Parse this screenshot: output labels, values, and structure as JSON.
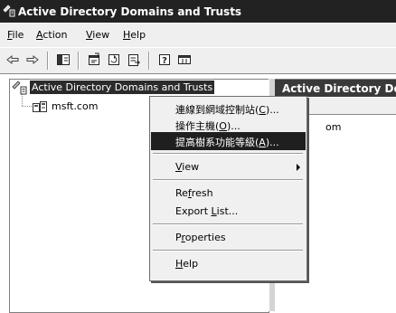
{
  "window": {
    "title": "Active Directory Domains and Trusts",
    "icon": "ad-domains-icon"
  },
  "menubar": [
    {
      "label": "File",
      "key": "F",
      "rest": "ile"
    },
    {
      "label": "Action",
      "key": "A",
      "rest": "ction"
    },
    {
      "label": "View",
      "key": "V",
      "rest": "iew"
    },
    {
      "label": "Help",
      "key": "H",
      "rest": "elp"
    }
  ],
  "toolbar": {
    "buttons": [
      "back-icon",
      "forward-icon",
      "show-hide-tree-icon",
      "properties-icon",
      "refresh-icon",
      "export-list-icon",
      "help-icon",
      "console-icon"
    ]
  },
  "tree": {
    "root_label": "Active Directory Domains and Trusts",
    "child_label": "msft.com"
  },
  "right_pane": {
    "header": "Active Directory Don",
    "partial_text": "om"
  },
  "context_menu": {
    "items": [
      {
        "pre": "連線到網域控制站(",
        "key": "C",
        "post": ")..."
      },
      {
        "pre": "操作主機(",
        "key": "O",
        "post": ")..."
      },
      {
        "pre": "提高樹系功能等級(",
        "key": "A",
        "post": ")...",
        "selected": true
      },
      {
        "pre": "",
        "key": "V",
        "post": "iew",
        "submenu": true
      },
      {
        "pre": "Re",
        "key": "f",
        "post": "resh"
      },
      {
        "pre": "Export ",
        "key": "L",
        "post": "ist..."
      },
      {
        "pre": "P",
        "key": "r",
        "post": "operties"
      },
      {
        "pre": "",
        "key": "H",
        "post": "elp"
      }
    ]
  }
}
